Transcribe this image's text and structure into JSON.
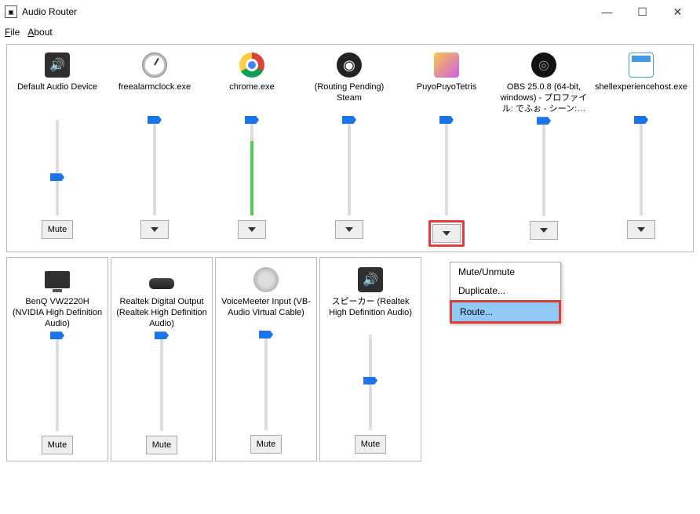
{
  "window": {
    "title": "Audio Router",
    "minimize_glyph": "—",
    "maximize_glyph": "☐",
    "close_glyph": "✕"
  },
  "menu": {
    "file": "File",
    "about": "About"
  },
  "buttons": {
    "mute": "Mute"
  },
  "top_row": [
    {
      "label": "Default Audio Device",
      "icon": "speaker-icon",
      "btn": "mute",
      "slider_pos": 0.4,
      "fill": 0
    },
    {
      "label": "freealarmclock.exe",
      "icon": "clock-icon",
      "btn": "dropdown",
      "slider_pos": 1.0,
      "fill": 0
    },
    {
      "label": "chrome.exe",
      "icon": "chrome-icon",
      "btn": "dropdown",
      "slider_pos": 1.0,
      "fill": 0.78
    },
    {
      "label": "(Routing Pending) Steam",
      "icon": "steam-icon",
      "btn": "dropdown",
      "slider_pos": 1.0,
      "fill": 0
    },
    {
      "label": "PuyoPuyoTetris",
      "icon": "puyo-icon",
      "btn": "dropdown",
      "slider_pos": 1.0,
      "fill": 0,
      "highlight": true
    },
    {
      "label": "OBS 25.0.8 (64-bit, windows) - プロファイル: でふぉ - シーン:…",
      "icon": "obs-icon",
      "btn": "dropdown",
      "slider_pos": 1.0,
      "fill": 0
    },
    {
      "label": "shellexperiencehost.exe",
      "icon": "shell-icon",
      "btn": "dropdown",
      "slider_pos": 1.0,
      "fill": 0
    }
  ],
  "bottom_row": [
    {
      "label": "BenQ VW2220H (NVIDIA High Definition Audio)",
      "icon": "monitor-icon",
      "slider_pos": 1.0
    },
    {
      "label": "Realtek Digital Output (Realtek High Definition Audio)",
      "icon": "cable-icon",
      "slider_pos": 1.0
    },
    {
      "label": "VoiceMeeter Input (VB-Audio Virtual Cable)",
      "icon": "voicemeeter-icon",
      "slider_pos": 1.0
    },
    {
      "label": "スピーカー (Realtek High Definition Audio)",
      "icon": "speaker-icon",
      "slider_pos": 0.52
    }
  ],
  "context_menu": {
    "mute_unmute": "Mute/Unmute",
    "duplicate": "Duplicate...",
    "route": "Route..."
  }
}
